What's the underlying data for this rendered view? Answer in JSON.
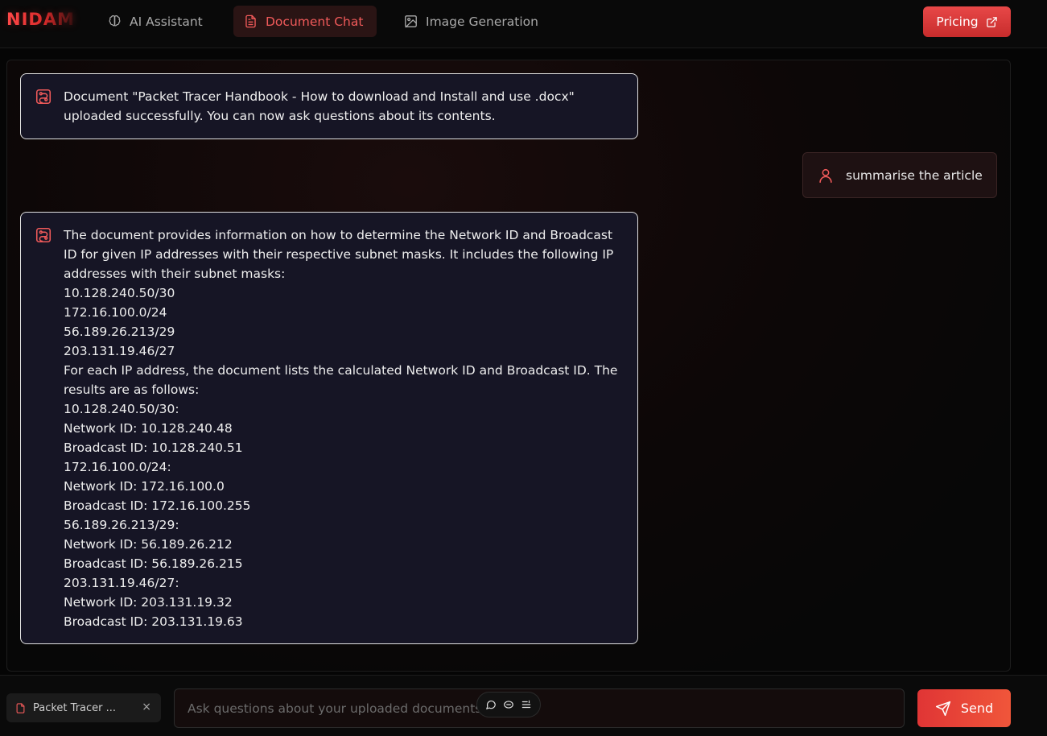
{
  "header": {
    "logo": "NIDAM",
    "tabs": [
      {
        "label": "AI Assistant",
        "icon": "brain-icon",
        "active": false
      },
      {
        "label": "Document Chat",
        "icon": "document-icon",
        "active": true
      },
      {
        "label": "Image Generation",
        "icon": "image-icon",
        "active": false
      }
    ],
    "pricing_label": "Pricing"
  },
  "messages": {
    "bot_1": "Document \"Packet Tracer Handbook - How to download and Install and use .docx\" uploaded successfully. You can now ask questions about its contents.",
    "user_1": "summarise the article",
    "bot_2": "The document provides information on how to determine the Network ID and Broadcast ID for given IP addresses with their respective subnet masks. It includes the following IP addresses with their subnet masks:\n10.128.240.50/30\n172.16.100.0/24\n56.189.26.213/29\n203.131.19.46/27\nFor each IP address, the document lists the calculated Network ID and Broadcast ID. The results are as follows:\n10.128.240.50/30:\nNetwork ID: 10.128.240.48\nBroadcast ID: 10.128.240.51\n172.16.100.0/24:\nNetwork ID: 172.16.100.0\nBroadcast ID: 172.16.100.255\n56.189.26.213/29:\nNetwork ID: 56.189.26.212\nBroadcast ID: 56.189.26.215\n203.131.19.46/27:\nNetwork ID: 203.131.19.32\nBroadcast ID: 203.131.19.63"
  },
  "footer": {
    "file_chip_label": "Packet Tracer ...",
    "file_chip_close": "×",
    "input_placeholder": "Ask questions about your uploaded documents",
    "send_label": "Send"
  },
  "colors": {
    "accent": "#e84848",
    "active_tab_bg": "#2a1414",
    "bot_bubble_bg": "#161525"
  }
}
